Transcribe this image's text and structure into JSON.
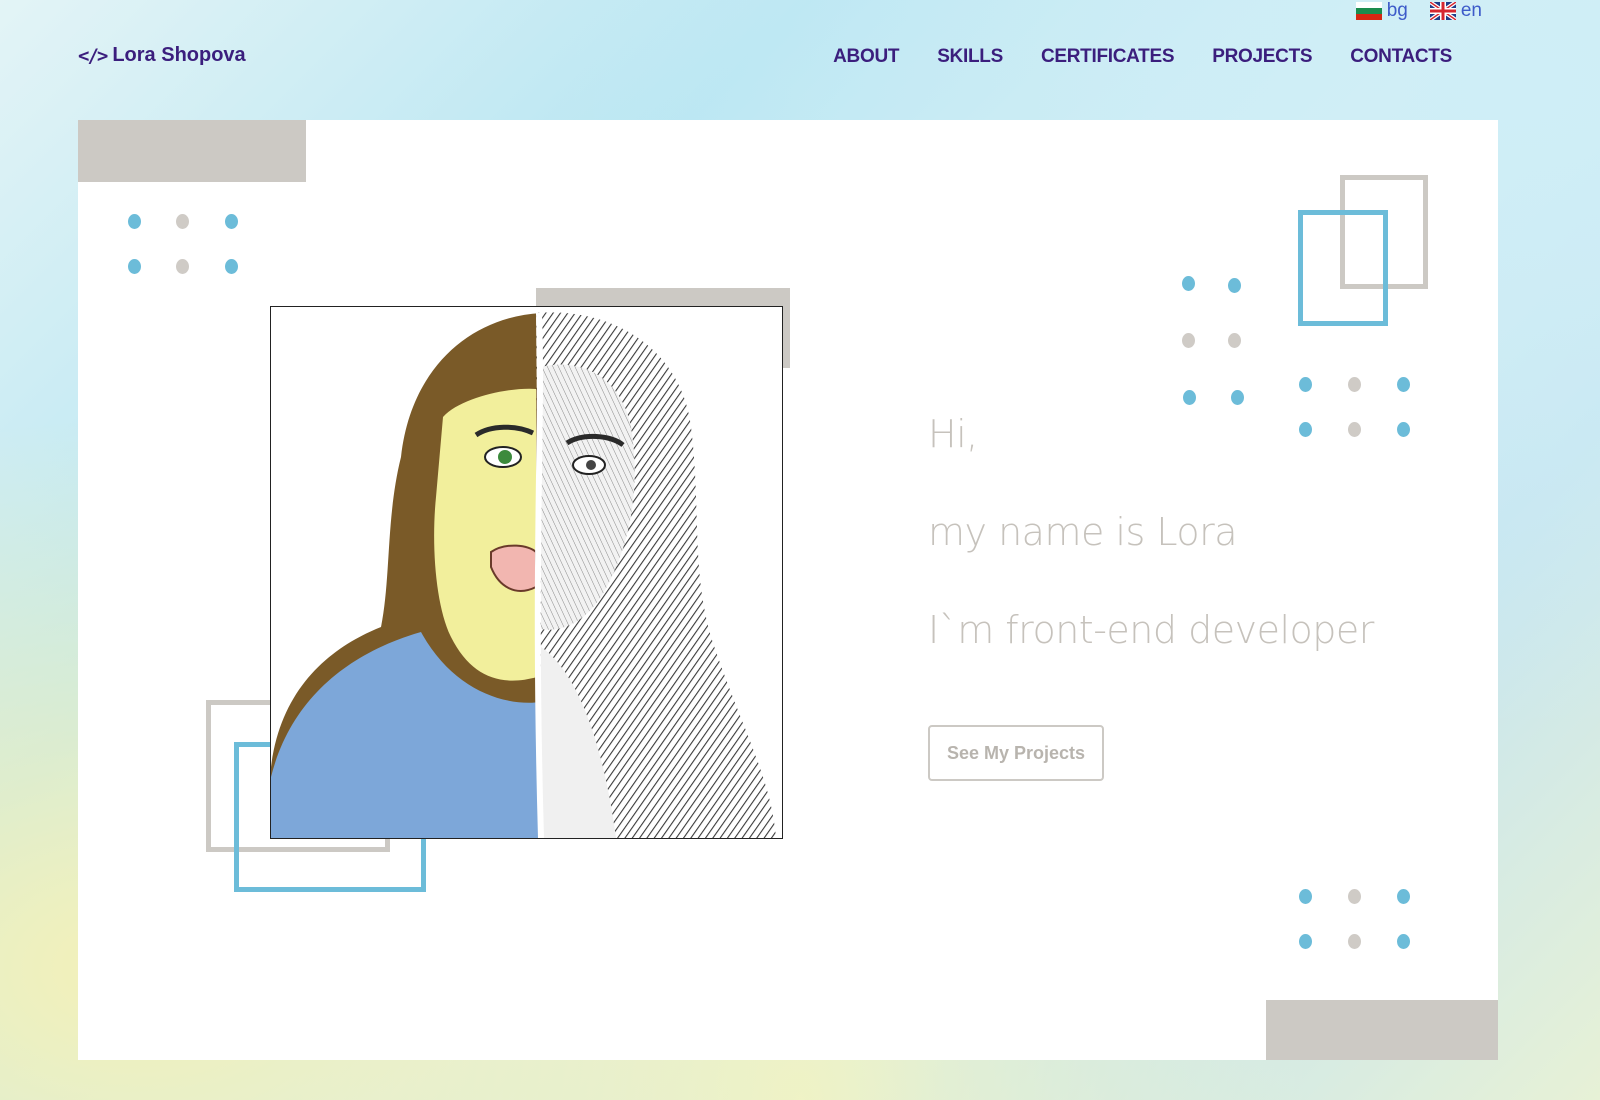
{
  "languages": [
    {
      "code": "bg",
      "label": "bg",
      "flag": "bulgaria-flag-icon"
    },
    {
      "code": "en",
      "label": "en",
      "flag": "uk-flag-icon"
    }
  ],
  "header": {
    "brand_icon": "</>",
    "brand_name": "Lora Shopova",
    "nav": [
      "ABOUT",
      "SKILLS",
      "CERTIFICATES",
      "PROJECTS",
      "CONTACTS"
    ]
  },
  "hero": {
    "greeting": "Hi,",
    "name_line": "my name is Lora",
    "role_line": "I`m front-end developer",
    "cta_label": "See My Projects"
  },
  "colors": {
    "nav_text": "#3b1e7d",
    "accent_blue": "#6cbcd9",
    "accent_gray": "#ccc9c4",
    "hero_text": "#c6c2bc"
  }
}
